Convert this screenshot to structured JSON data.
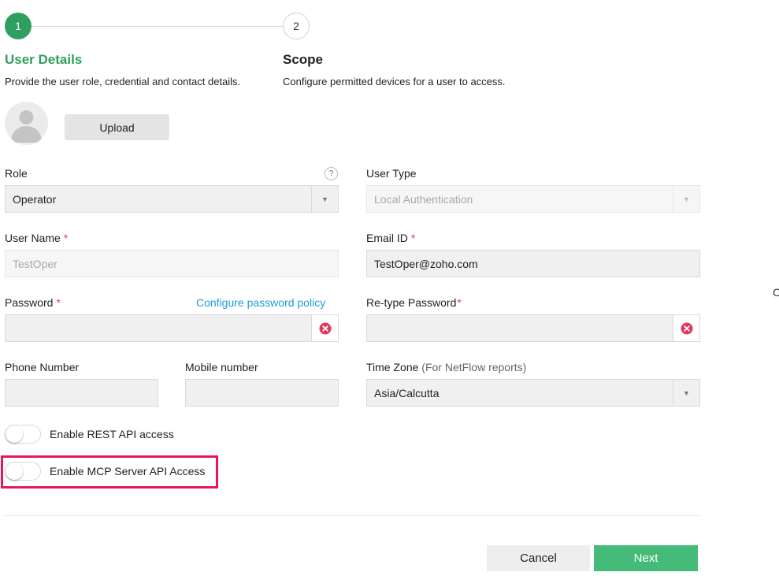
{
  "stepper": {
    "steps": [
      {
        "number": "1",
        "title": "User Details",
        "description": "Provide the user role, credential and contact details."
      },
      {
        "number": "2",
        "title": "Scope",
        "description": "Configure permitted devices for a user to access."
      }
    ]
  },
  "avatar": {
    "upload_label": "Upload"
  },
  "form": {
    "role": {
      "label": "Role",
      "value": "Operator",
      "help": "?"
    },
    "user_type": {
      "label": "User Type",
      "value": "Local Authentication"
    },
    "user_name": {
      "label": "User Name",
      "value": "TestOper",
      "required": "*"
    },
    "email": {
      "label": "Email ID",
      "value": "TestOper@zoho.com",
      "required": "*"
    },
    "password": {
      "label": "Password",
      "value": "",
      "required": "*",
      "link": "Configure password policy"
    },
    "retype_password": {
      "label": "Re-type Password",
      "value": "",
      "required": "*"
    },
    "phone": {
      "label": "Phone Number",
      "value": ""
    },
    "mobile": {
      "label": "Mobile number",
      "value": ""
    },
    "time_zone": {
      "label": "Time Zone",
      "label_note": "(For NetFlow reports)",
      "value": "Asia/Calcutta"
    }
  },
  "toggles": {
    "rest_api": {
      "label": "Enable REST API access",
      "enabled": false
    },
    "mcp_api": {
      "label": "Enable MCP Server API Access",
      "enabled": false
    }
  },
  "footer": {
    "cancel_label": "Cancel",
    "next_label": "Next"
  },
  "edge_text": "C",
  "colors": {
    "accent": "#2e9f5e",
    "next_button": "#45bb7a",
    "link": "#1e9bd7",
    "required": "#e0395a",
    "highlight": "#e8175d",
    "clear_icon": "#e0395a"
  }
}
